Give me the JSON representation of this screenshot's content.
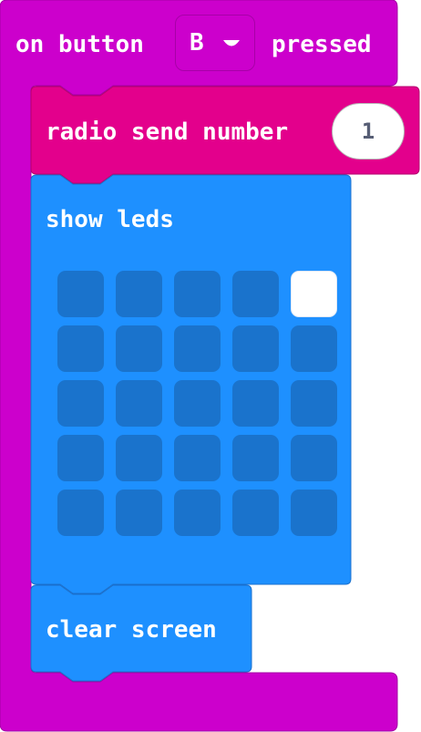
{
  "event_block": {
    "prefix_label": "on button",
    "button_value": "B",
    "suffix_label": "pressed",
    "color": "#cc00cc"
  },
  "radio_block": {
    "label": "radio send number",
    "number_value": "1",
    "color": "#e3008c"
  },
  "show_leds_block": {
    "label": "show leds",
    "color": "#1e90ff",
    "led_off_color": "#1a73cc",
    "led_on_color": "#ffffff",
    "leds": [
      [
        false,
        false,
        false,
        false,
        true
      ],
      [
        false,
        false,
        false,
        false,
        false
      ],
      [
        false,
        false,
        false,
        false,
        false
      ],
      [
        false,
        false,
        false,
        false,
        false
      ],
      [
        false,
        false,
        false,
        false,
        false
      ]
    ]
  },
  "clear_block": {
    "label": "clear screen",
    "color": "#1e90ff"
  }
}
